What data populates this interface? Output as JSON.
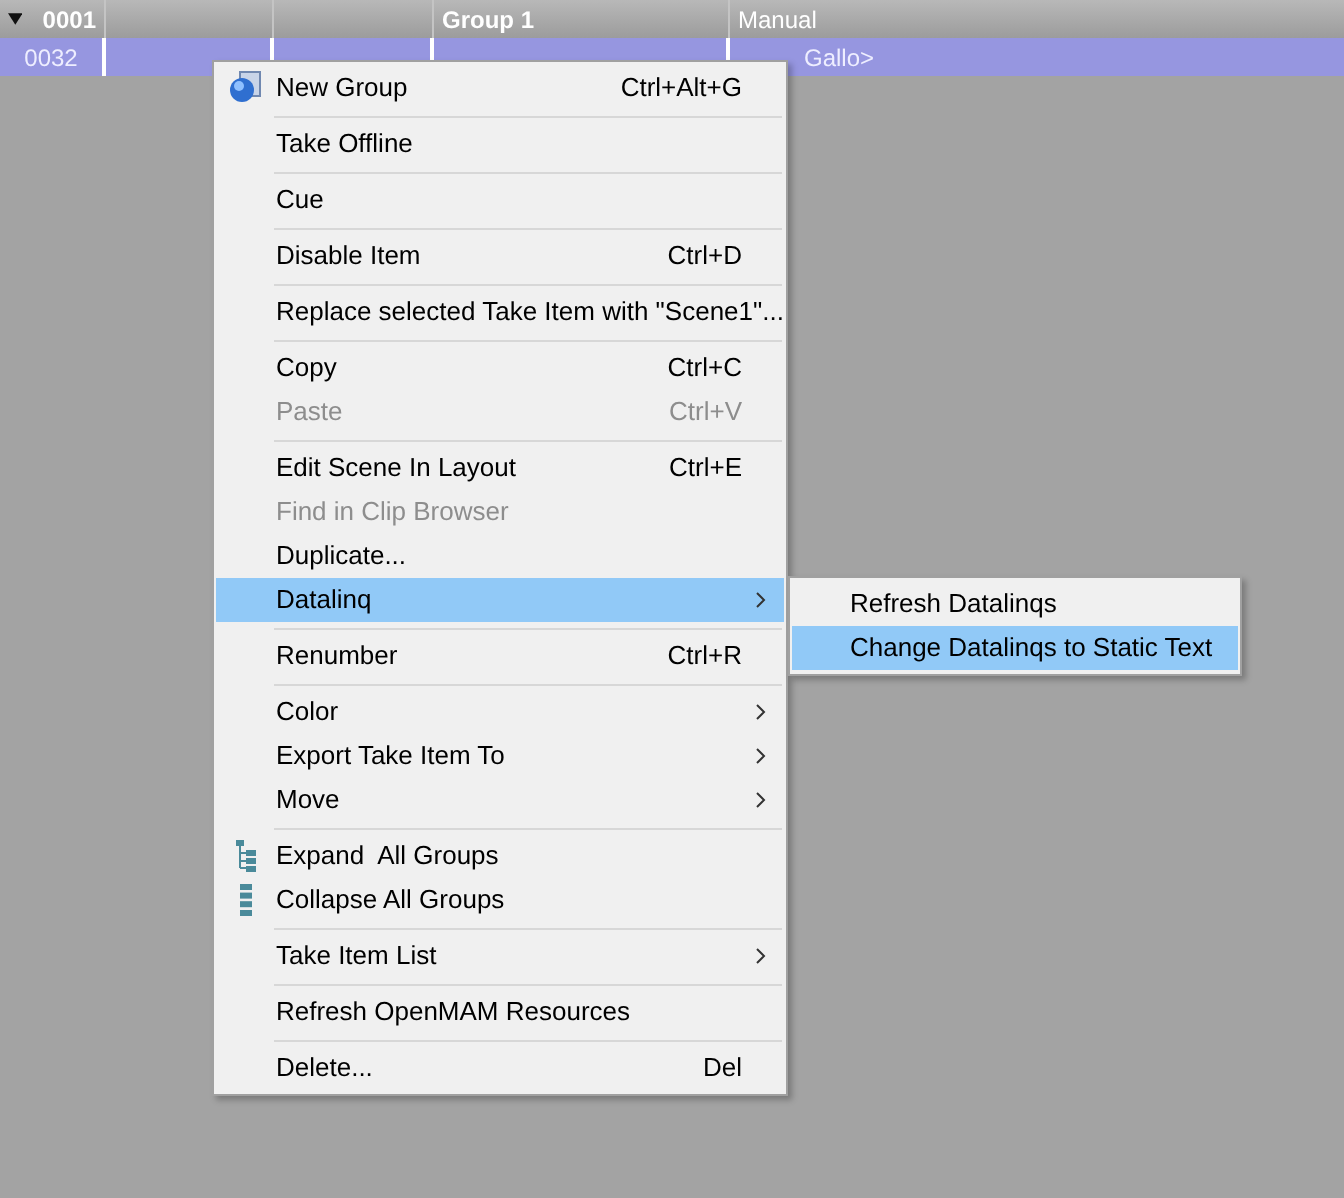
{
  "table": {
    "group_row": {
      "expanded": true,
      "number": "0001",
      "name": "Group 1",
      "column_5": "Manual"
    },
    "rows": [
      {
        "selected": true,
        "number": "0032",
        "column_5": "Gallo>"
      }
    ]
  },
  "context_menu": {
    "items": [
      {
        "kind": "newgroup",
        "label": "New Group",
        "shortcut": "Ctrl+Alt+G",
        "submenu": false,
        "disabled": false,
        "selected": false
      },
      {
        "kind": "separator"
      },
      {
        "kind": "item",
        "label": "Take Offline",
        "submenu": false,
        "disabled": false,
        "selected": false
      },
      {
        "kind": "separator"
      },
      {
        "kind": "item",
        "label": "Cue",
        "submenu": false,
        "disabled": false,
        "selected": false
      },
      {
        "kind": "separator"
      },
      {
        "kind": "item",
        "label": "Disable Item",
        "shortcut": "Ctrl+D",
        "submenu": false,
        "disabled": false,
        "selected": false
      },
      {
        "kind": "separator"
      },
      {
        "kind": "item",
        "label": "Replace selected Take Item with \"Scene1\"...",
        "submenu": false,
        "disabled": false,
        "selected": false
      },
      {
        "kind": "separator"
      },
      {
        "kind": "item",
        "label": "Copy",
        "shortcut": "Ctrl+C",
        "submenu": false,
        "disabled": false,
        "selected": false
      },
      {
        "kind": "item",
        "label": "Paste",
        "shortcut": "Ctrl+V",
        "submenu": false,
        "disabled": true,
        "selected": false
      },
      {
        "kind": "separator"
      },
      {
        "kind": "item",
        "label": "Edit Scene In Layout",
        "shortcut": "Ctrl+E",
        "submenu": false,
        "disabled": false,
        "selected": false
      },
      {
        "kind": "item",
        "label": "Find in Clip Browser",
        "submenu": false,
        "disabled": true,
        "selected": false
      },
      {
        "kind": "item",
        "label": "Duplicate...",
        "submenu": false,
        "disabled": false,
        "selected": false
      },
      {
        "kind": "item",
        "label": "Datalinq",
        "submenu": true,
        "disabled": false,
        "selected": true
      },
      {
        "kind": "separator"
      },
      {
        "kind": "item",
        "label": "Renumber",
        "shortcut": "Ctrl+R",
        "submenu": false,
        "disabled": false,
        "selected": false
      },
      {
        "kind": "separator"
      },
      {
        "kind": "item",
        "label": "Color",
        "submenu": true,
        "disabled": false,
        "selected": false
      },
      {
        "kind": "item",
        "label": "Export Take Item To",
        "submenu": true,
        "disabled": false,
        "selected": false
      },
      {
        "kind": "item",
        "label": "Move",
        "submenu": true,
        "disabled": false,
        "selected": false
      },
      {
        "kind": "separator"
      },
      {
        "kind": "expand",
        "label": "Expand  All Groups",
        "submenu": false,
        "disabled": false,
        "selected": false
      },
      {
        "kind": "collapse",
        "label": "Collapse All Groups",
        "submenu": false,
        "disabled": false,
        "selected": false
      },
      {
        "kind": "separator"
      },
      {
        "kind": "item",
        "label": "Take Item List",
        "submenu": true,
        "disabled": false,
        "selected": false
      },
      {
        "kind": "separator"
      },
      {
        "kind": "item",
        "label": "Refresh OpenMAM Resources",
        "submenu": false,
        "disabled": false,
        "selected": false
      },
      {
        "kind": "separator"
      },
      {
        "kind": "item",
        "label": "Delete...",
        "shortcut": "Del",
        "submenu": false,
        "disabled": false,
        "selected": false
      }
    ]
  },
  "submenu": {
    "items": [
      {
        "label": "Refresh Datalinqs",
        "selected": false
      },
      {
        "label": "Change Datalinqs to Static Text",
        "selected": true
      }
    ]
  }
}
